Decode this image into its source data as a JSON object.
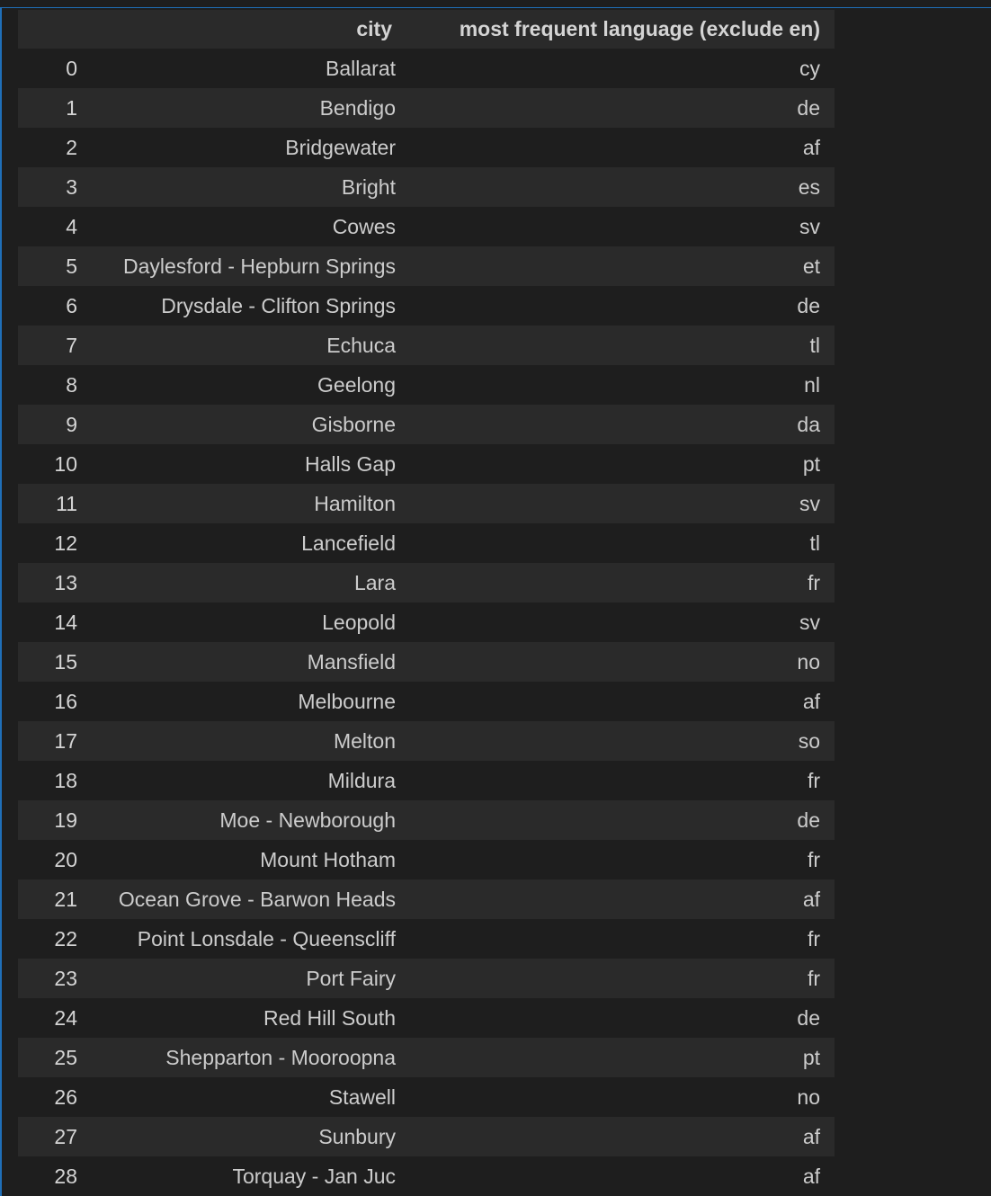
{
  "table": {
    "columns": {
      "index": "",
      "city": "city",
      "language": "most frequent language (exclude en)"
    },
    "rows": [
      {
        "index": "0",
        "city": "Ballarat",
        "language": "cy"
      },
      {
        "index": "1",
        "city": "Bendigo",
        "language": "de"
      },
      {
        "index": "2",
        "city": "Bridgewater",
        "language": "af"
      },
      {
        "index": "3",
        "city": "Bright",
        "language": "es"
      },
      {
        "index": "4",
        "city": "Cowes",
        "language": "sv"
      },
      {
        "index": "5",
        "city": "Daylesford - Hepburn Springs",
        "language": "et"
      },
      {
        "index": "6",
        "city": "Drysdale - Clifton Springs",
        "language": "de"
      },
      {
        "index": "7",
        "city": "Echuca",
        "language": "tl"
      },
      {
        "index": "8",
        "city": "Geelong",
        "language": "nl"
      },
      {
        "index": "9",
        "city": "Gisborne",
        "language": "da"
      },
      {
        "index": "10",
        "city": "Halls Gap",
        "language": "pt"
      },
      {
        "index": "11",
        "city": "Hamilton",
        "language": "sv"
      },
      {
        "index": "12",
        "city": "Lancefield",
        "language": "tl"
      },
      {
        "index": "13",
        "city": "Lara",
        "language": "fr"
      },
      {
        "index": "14",
        "city": "Leopold",
        "language": "sv"
      },
      {
        "index": "15",
        "city": "Mansfield",
        "language": "no"
      },
      {
        "index": "16",
        "city": "Melbourne",
        "language": "af"
      },
      {
        "index": "17",
        "city": "Melton",
        "language": "so"
      },
      {
        "index": "18",
        "city": "Mildura",
        "language": "fr"
      },
      {
        "index": "19",
        "city": "Moe - Newborough",
        "language": "de"
      },
      {
        "index": "20",
        "city": "Mount Hotham",
        "language": "fr"
      },
      {
        "index": "21",
        "city": "Ocean Grove - Barwon Heads",
        "language": "af"
      },
      {
        "index": "22",
        "city": "Point Lonsdale - Queenscliff",
        "language": "fr"
      },
      {
        "index": "23",
        "city": "Port Fairy",
        "language": "fr"
      },
      {
        "index": "24",
        "city": "Red Hill South",
        "language": "de"
      },
      {
        "index": "25",
        "city": "Shepparton - Mooroopna",
        "language": "pt"
      },
      {
        "index": "26",
        "city": "Stawell",
        "language": "no"
      },
      {
        "index": "27",
        "city": "Sunbury",
        "language": "af"
      },
      {
        "index": "28",
        "city": "Torquay - Jan Juc",
        "language": "af"
      }
    ]
  }
}
